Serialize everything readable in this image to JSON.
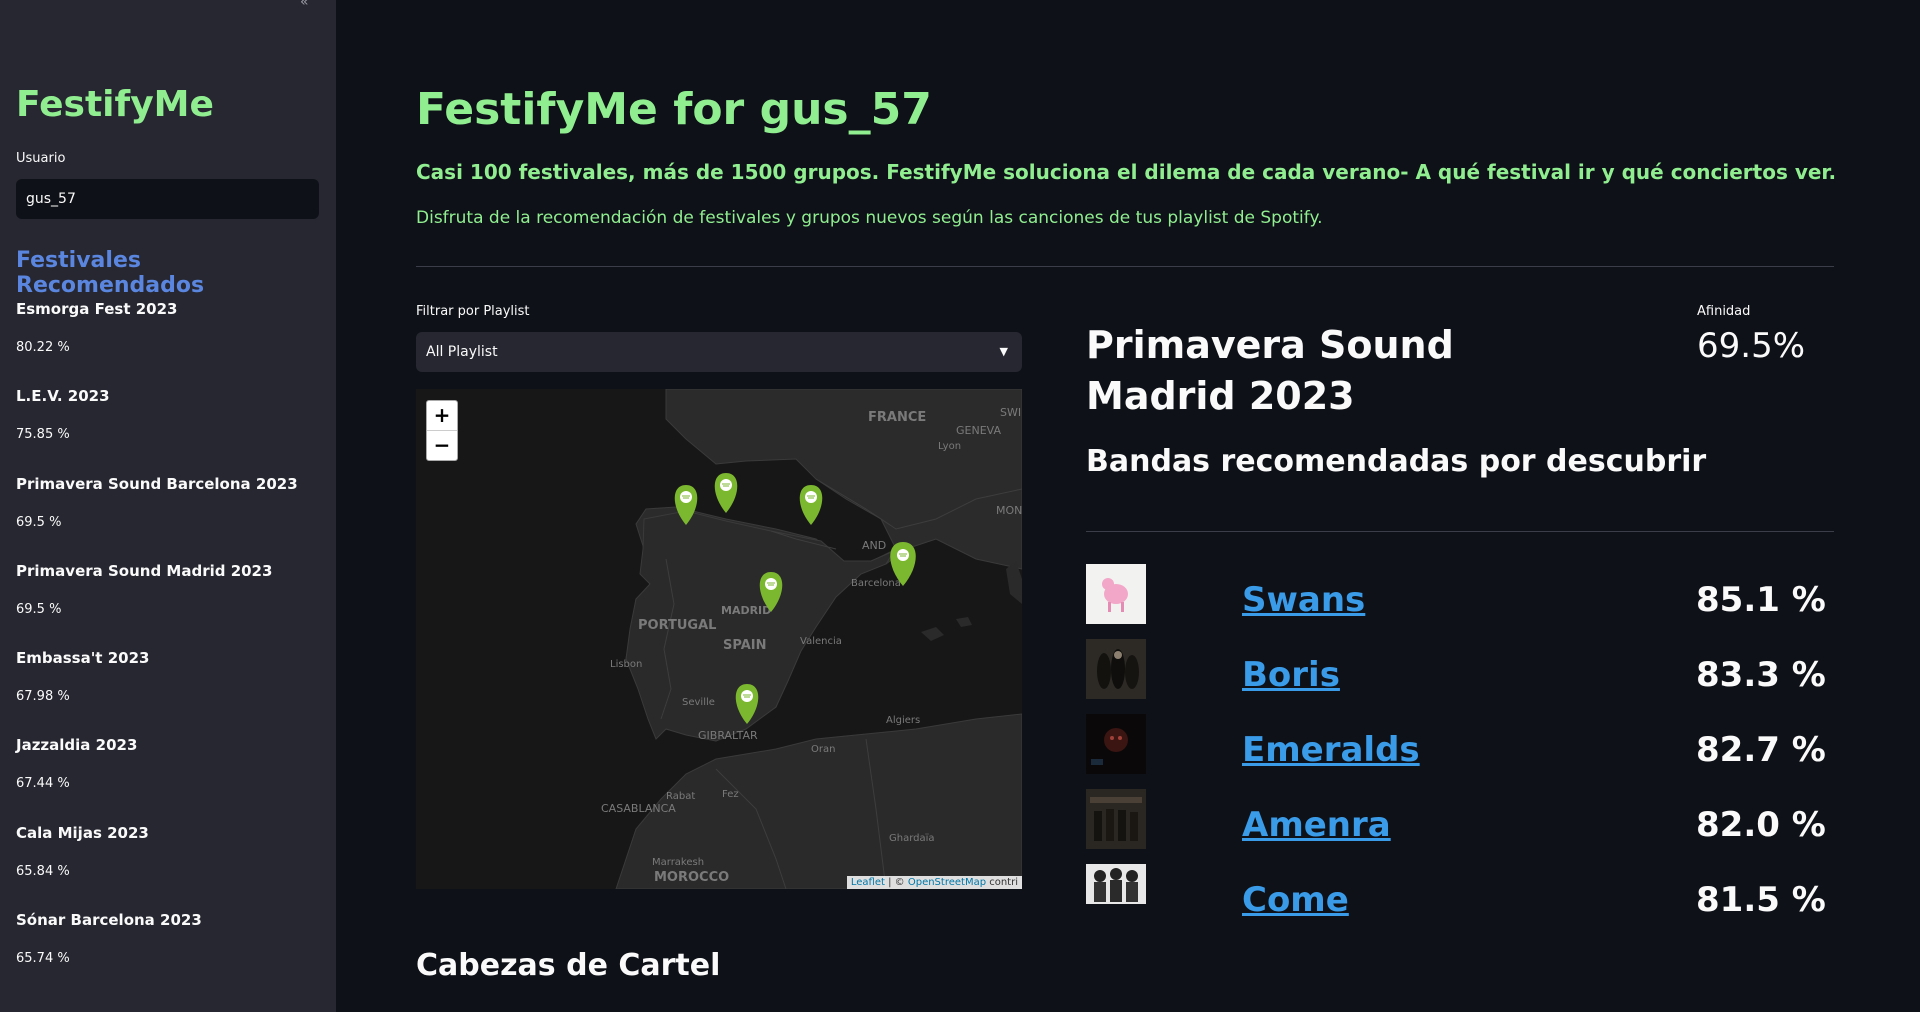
{
  "sidebar": {
    "collapse_glyph": "«",
    "app_title": "FestifyMe",
    "user_label": "Usuario",
    "user_value": "gus_57",
    "section_title": "Festivales Recomendados",
    "festivals": [
      {
        "name": "Esmorga Fest 2023",
        "score": "80.22 %"
      },
      {
        "name": "L.E.V. 2023",
        "score": "75.85 %"
      },
      {
        "name": "Primavera Sound Barcelona 2023",
        "score": "69.5 %"
      },
      {
        "name": "Primavera Sound Madrid 2023",
        "score": "69.5 %"
      },
      {
        "name": "Embassa't 2023",
        "score": "67.98 %"
      },
      {
        "name": "Jazzaldia 2023",
        "score": "67.44 %"
      },
      {
        "name": "Cala Mijas 2023",
        "score": "65.84 %"
      },
      {
        "name": "Sónar Barcelona 2023",
        "score": "65.74 %"
      }
    ]
  },
  "main": {
    "title": "FestifyMe for gus_57",
    "subtitle": "Casi 100 festivales, más de 1500 grupos. FestifyMe soluciona el dilema de cada verano- A qué festival ir y qué conciertos ver.",
    "description": "Disfruta de la recomendación de festivales y grupos nuevos según las canciones de tus playlist de Spotify.",
    "filter_label": "Filtrar por Playlist",
    "filter_value": "All Playlist",
    "map": {
      "zoom_in": "+",
      "zoom_out": "−",
      "attribution_leaflet": "Leaflet",
      "attribution_sep": " | © ",
      "attribution_osm": "OpenStreetMap",
      "attribution_rest": " contri",
      "labels": {
        "france": "FRANCE",
        "geneva": "GENEVA",
        "lyon": "Lyon",
        "swi": "SWI",
        "mon": "MON",
        "andorra": "AND",
        "barcelona": "Barcelona",
        "madrid": "MADRID",
        "portugal": "PORTUGAL",
        "spain": "SPAIN",
        "valencia": "Valencia",
        "lisbon": "Lisbon",
        "seville": "Seville",
        "gibraltar": "GIBRALTAR",
        "algiers": "Algiers",
        "oran": "Oran",
        "rabat": "Rabat",
        "fez": "Fez",
        "casablanca": "CASABLANCA",
        "ghardaia": "Ghardaïa",
        "marrakesh": "Marrakesh",
        "morocco": "MOROCCO"
      },
      "marker_count": 6
    },
    "festival_title": "Primavera Sound Madrid 2023",
    "affinity_label": "Afinidad",
    "affinity_value": "69.5%",
    "bands_title": "Bandas recomendadas por descubrir",
    "bands": [
      {
        "name": "Swans",
        "score": "85.1 %"
      },
      {
        "name": "Boris",
        "score": "83.3 %"
      },
      {
        "name": "Emeralds",
        "score": "82.7 %"
      },
      {
        "name": "Amenra",
        "score": "82.0 %"
      },
      {
        "name": "Come",
        "score": "81.5 %"
      }
    ],
    "headliners_title": "Cabezas de Cartel"
  },
  "colors": {
    "accent_green": "#90ee90",
    "section_blue": "#5b86e0",
    "link_blue": "#3a9be8",
    "marker_green": "#7cb82f"
  }
}
